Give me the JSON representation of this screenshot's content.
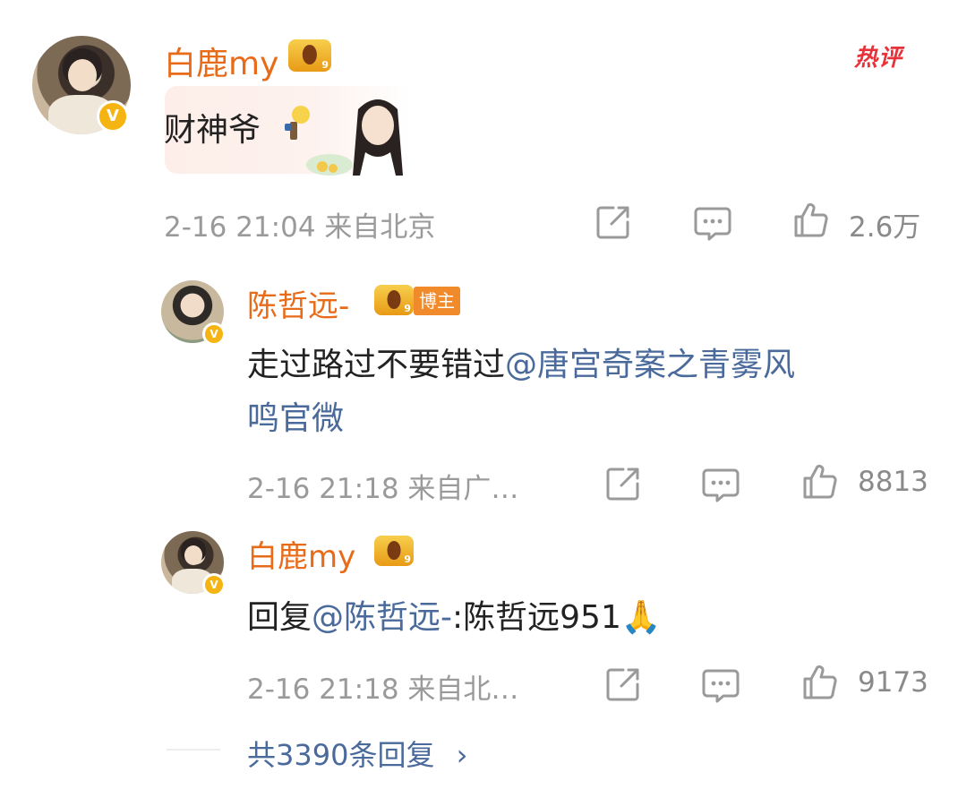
{
  "top_comment": {
    "username": "白鹿my",
    "crown_level": "9",
    "hot_tag": "热评",
    "text": "财神爷",
    "meta": "2-16 21:04 来自北京",
    "likes": "2.6万"
  },
  "replies": [
    {
      "username": "陈哲远-",
      "crown_level": "9",
      "role_badge": "博主",
      "text_prefix": "走过路过不要错过",
      "mention_line1": "@唐宫奇案之青雾风",
      "mention_line2": "鸣官微",
      "meta": "2-16 21:18 来自广…",
      "likes": "8813"
    },
    {
      "username": "白鹿my",
      "crown_level": "9",
      "reply_word": "回复",
      "mention": "@陈哲远-",
      "text_after": ":陈哲远951",
      "emoji": "🙏",
      "meta": "2-16 21:18 来自北…",
      "likes": "9173"
    }
  ],
  "more_replies": {
    "label": "共3390条回复",
    "chevron": "›"
  },
  "icons": {
    "share": "share-icon",
    "comment": "comment-icon",
    "like": "thumbs-up-icon",
    "verified": "verified-v-icon"
  },
  "colors": {
    "username": "#e86b19",
    "mention": "#4a6a9b",
    "meta": "#9a9a9a",
    "hot": "#e8323a",
    "verified": "#f5b412"
  }
}
